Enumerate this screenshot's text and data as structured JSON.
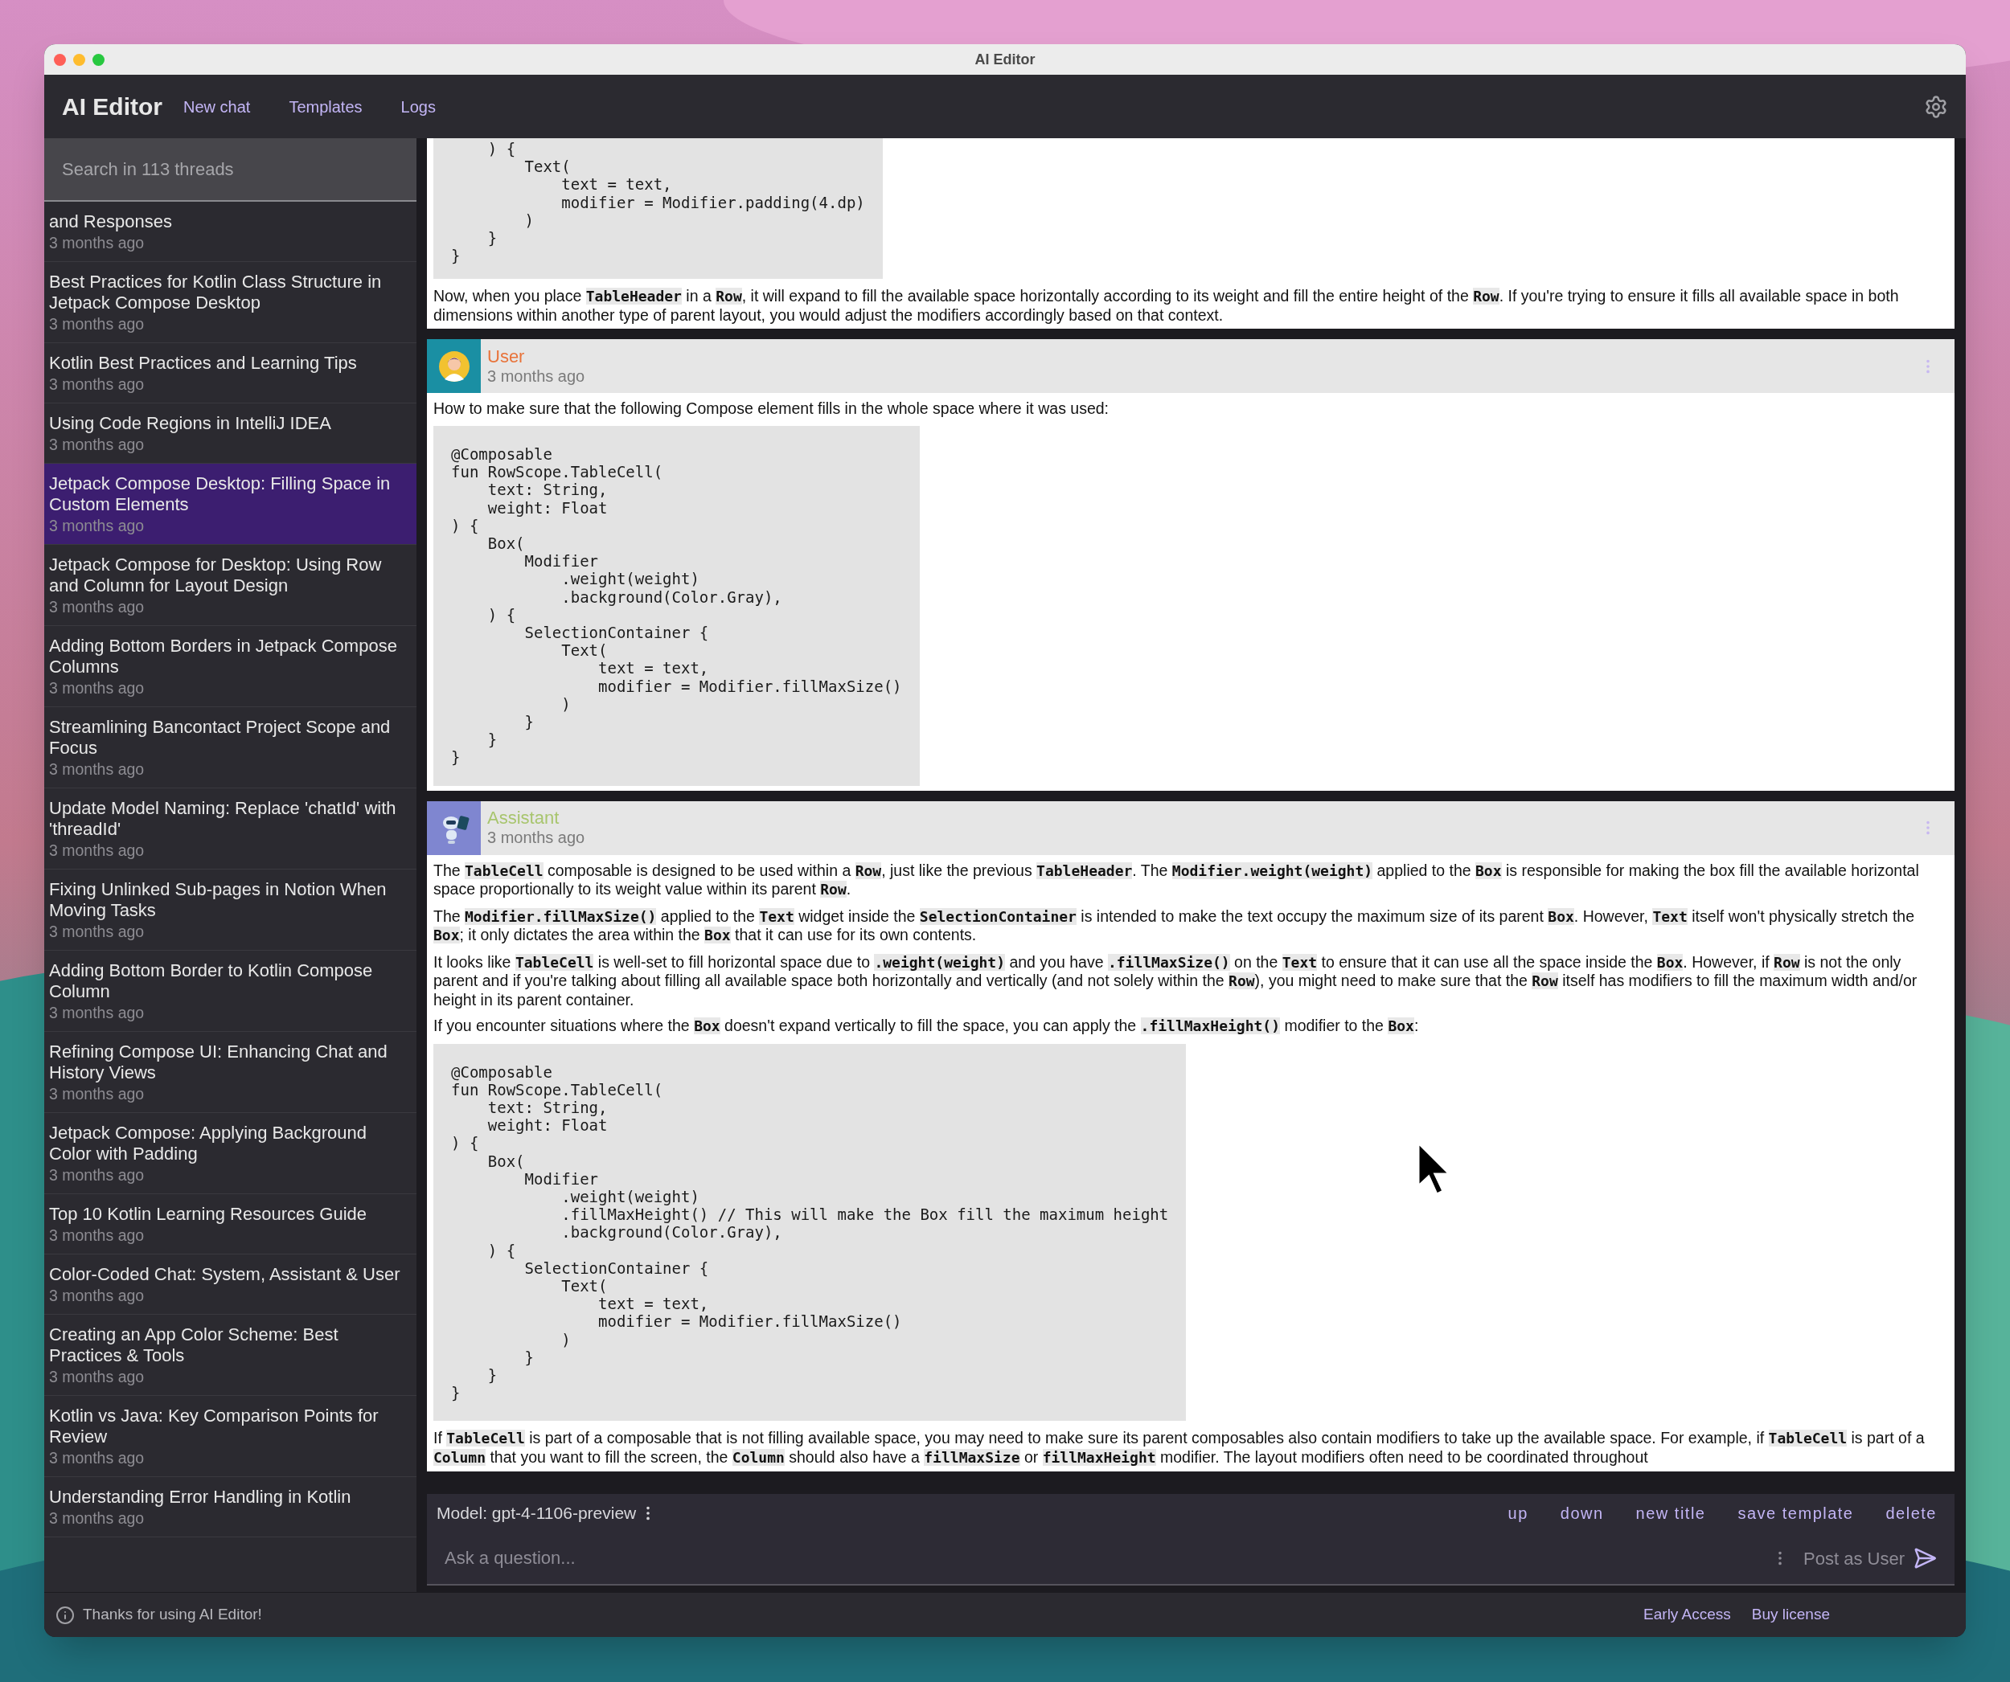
{
  "window": {
    "title": "AI Editor"
  },
  "app_bar": {
    "title": "AI Editor",
    "links": [
      "New chat",
      "Templates",
      "Logs"
    ]
  },
  "sidebar": {
    "search": {
      "placeholder": "Search in 113 threads"
    },
    "threads": [
      {
        "title": "and Responses",
        "time": "3 months ago",
        "selected": false
      },
      {
        "title": "Best Practices for Kotlin Class Structure in Jetpack Compose Desktop",
        "time": "3 months ago",
        "selected": false
      },
      {
        "title": "Kotlin Best Practices and Learning Tips",
        "time": "3 months ago",
        "selected": false
      },
      {
        "title": "Using Code Regions in IntelliJ IDEA",
        "time": "3 months ago",
        "selected": false
      },
      {
        "title": "Jetpack Compose Desktop: Filling Space in Custom Elements",
        "time": "3 months ago",
        "selected": true
      },
      {
        "title": "Jetpack Compose for Desktop: Using Row and Column for Layout Design",
        "time": "3 months ago",
        "selected": false
      },
      {
        "title": "Adding Bottom Borders in Jetpack Compose Columns",
        "time": "3 months ago",
        "selected": false
      },
      {
        "title": "Streamlining Bancontact Project Scope and Focus",
        "time": "3 months ago",
        "selected": false
      },
      {
        "title": "Update Model Naming: Replace 'chatId' with 'threadId'",
        "time": "3 months ago",
        "selected": false
      },
      {
        "title": "Fixing Unlinked Sub-pages in Notion When Moving Tasks",
        "time": "3 months ago",
        "selected": false
      },
      {
        "title": "Adding Bottom Border to Kotlin Compose Column",
        "time": "3 months ago",
        "selected": false
      },
      {
        "title": "Refining Compose UI: Enhancing Chat and History Views",
        "time": "3 months ago",
        "selected": false
      },
      {
        "title": "Jetpack Compose: Applying Background Color with Padding",
        "time": "3 months ago",
        "selected": false
      },
      {
        "title": "Top 10 Kotlin Learning Resources Guide",
        "time": "3 months ago",
        "selected": false
      },
      {
        "title": "Color-Coded Chat: System, Assistant & User",
        "time": "3 months ago",
        "selected": false
      },
      {
        "title": "Creating an App Color Scheme: Best Practices & Tools",
        "time": "3 months ago",
        "selected": false
      },
      {
        "title": "Kotlin vs Java: Key Comparison Points for Review",
        "time": "3 months ago",
        "selected": false
      },
      {
        "title": "Understanding Error Handling in Kotlin",
        "time": "3 months ago",
        "selected": false
      }
    ]
  },
  "messages": [
    {
      "kind": "assistant",
      "blocks": [
        {
          "kind": "code",
          "text": "    ) {\n        Text(\n            text = text,\n            modifier = Modifier.padding(4.dp)\n        )\n    }\n}"
        },
        {
          "kind": "text",
          "text": "Now, when you place **TableHeader** in a **Row**, it will expand to fill the available space horizontally according to its weight and fill the entire height of the **Row**. If you're trying to ensure it fills all available space in both dimensions within another type of parent layout, you would adjust the modifiers accordingly based on that context."
        }
      ]
    },
    {
      "kind": "user",
      "author": "User",
      "time": "3 months ago",
      "blocks": [
        {
          "kind": "text",
          "text": "How to make sure that the following Compose element fills in the whole space where it was used:"
        },
        {
          "kind": "code",
          "text": "@Composable\nfun RowScope.TableCell(\n    text: String,\n    weight: Float\n) {\n    Box(\n        Modifier\n            .weight(weight)\n            .background(Color.Gray),\n    ) {\n        SelectionContainer {\n            Text(\n                text = text,\n                modifier = Modifier.fillMaxSize()\n            )\n        }\n    }\n}"
        }
      ]
    },
    {
      "kind": "assistant",
      "author": "Assistant",
      "time": "3 months ago",
      "blocks": [
        {
          "kind": "text",
          "text": "The **TableCell** composable is designed to be used within a **Row**, just like the previous **TableHeader**. The **Modifier.weight(weight)** applied to the **Box** is responsible for making the box fill the available horizontal space proportionally to its weight value within its parent **Row**."
        },
        {
          "kind": "text",
          "text": "The **Modifier.fillMaxSize()** applied to the **Text** widget inside the **SelectionContainer** is intended to make the text occupy the maximum size of its parent **Box**. However, **Text** itself won't physically stretch the **Box**; it only dictates the area within the **Box** that it can use for its own contents."
        },
        {
          "kind": "text",
          "text": "It looks like **TableCell** is well-set to fill horizontal space due to **.weight(weight)** and you have **.fillMaxSize()** on the **Text** to ensure that it can use all the space inside the **Box**. However, if **Row** is not the only parent and if you're talking about filling all available space both horizontally and vertically (and not solely within the **Row**), you might need to make sure that the **Row** itself has modifiers to fill the maximum width and/or height in its parent container."
        },
        {
          "kind": "text",
          "text": "If you encounter situations where the **Box** doesn't expand vertically to fill the space, you can apply the **.fillMaxHeight()** modifier to the **Box**:"
        },
        {
          "kind": "code",
          "text": "@Composable\nfun RowScope.TableCell(\n    text: String,\n    weight: Float\n) {\n    Box(\n        Modifier\n            .weight(weight)\n            .fillMaxHeight() // This will make the Box fill the maximum height\n            .background(Color.Gray),\n    ) {\n        SelectionContainer {\n            Text(\n                text = text,\n                modifier = Modifier.fillMaxSize()\n            )\n        }\n    }\n}"
        },
        {
          "kind": "text",
          "text": "If **TableCell** is part of a composable that is not filling available space, you may need to make sure its parent composables also contain modifiers to take up the available space. For example, if **TableCell** is part of a **Column** that you want to fill the screen, the **Column** should also have a **fillMaxSize** or **fillMaxHeight** modifier. The layout modifiers often need to be coordinated throughout"
        }
      ]
    }
  ],
  "composer": {
    "model": "Model: gpt-4-1106-preview",
    "actions": [
      "up",
      "down",
      "new title",
      "save template",
      "delete"
    ],
    "input": {
      "placeholder": "Ask a question..."
    },
    "post_button": "Post as User"
  },
  "status_bar": {
    "message": "Thanks for using AI Editor!",
    "links": [
      "Early Access",
      "Buy license"
    ]
  }
}
